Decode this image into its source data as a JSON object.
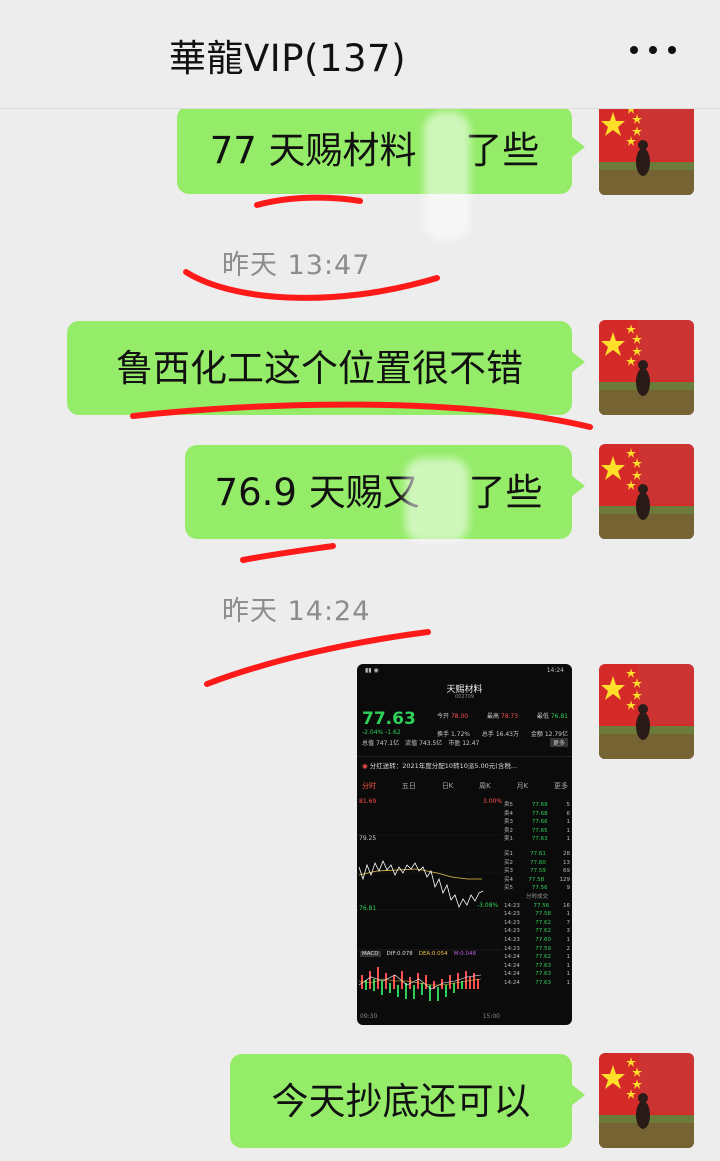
{
  "header": {
    "title": "華龍VIP(137)"
  },
  "messages": [
    {
      "text": "77 天赐材料  了些"
    },
    {
      "timestamp": "昨天 13:47"
    },
    {
      "text": "鲁西化工这个位置很不错"
    },
    {
      "text": "76.9 天赐又  了些"
    },
    {
      "timestamp": "昨天 14:24"
    },
    {
      "text": "今天抄底还可以"
    }
  ],
  "stock": {
    "status_time": "14:24",
    "name": "天赐材料",
    "code": "002709",
    "price": "77.63",
    "change": "-2.04%  -1.62",
    "row1": [
      "今开",
      "78.00",
      "最高",
      "78.73",
      "最低",
      "76.81"
    ],
    "row2": [
      "换手",
      "1.72%",
      "总手",
      "16.43万",
      "金额",
      "12.79亿"
    ],
    "row3": [
      "总值",
      "747.1亿",
      "流值",
      "743.5亿",
      "市盈",
      "12.47"
    ],
    "more": "更多",
    "notice": "分红送转：2021年度分配10转10派5.00元(含税...",
    "tabs": [
      "分时",
      "五日",
      "日K",
      "周K",
      "月K",
      "更多"
    ],
    "chart_top": "81.69",
    "chart_mid": "79.25",
    "chart_low": "76.81",
    "pct_top": "3.00%",
    "pct_low": "-3.08%",
    "asks": [
      [
        "卖5",
        "77.69",
        "5"
      ],
      [
        "卖4",
        "77.68",
        "6"
      ],
      [
        "卖3",
        "77.66",
        "1"
      ],
      [
        "卖2",
        "77.65",
        "1"
      ],
      [
        "卖1",
        "77.63",
        "1"
      ]
    ],
    "bids": [
      [
        "买1",
        "77.61",
        "28"
      ],
      [
        "买2",
        "77.60",
        "13"
      ],
      [
        "买3",
        "77.59",
        "69"
      ],
      [
        "买4",
        "77.58",
        "129"
      ],
      [
        "买5",
        "77.56",
        "9"
      ]
    ],
    "trades_label": "分时成交",
    "trades": [
      [
        "14:23",
        "77.56",
        "16"
      ],
      [
        "14:23",
        "77.58",
        "1"
      ],
      [
        "14:23",
        "77.62",
        "7"
      ],
      [
        "14:23",
        "77.62",
        "3"
      ],
      [
        "14:23",
        "77.60",
        "1"
      ],
      [
        "14:23",
        "77.59",
        "2"
      ],
      [
        "14:24",
        "77.62",
        "1"
      ],
      [
        "14:24",
        "77.63",
        "1"
      ],
      [
        "14:24",
        "77.63",
        "1"
      ],
      [
        "14:24",
        "77.63",
        "1"
      ]
    ],
    "macd": [
      "MACD",
      "DIF:0.078",
      "DEA:0.054",
      "M:0.048"
    ],
    "time_start": "09:30",
    "time_end": "15:00"
  }
}
